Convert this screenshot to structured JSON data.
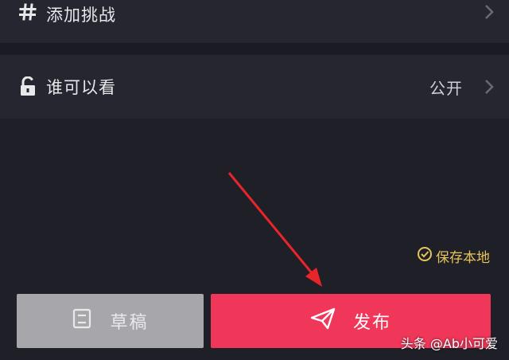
{
  "challenge_row": {
    "label": "添加挑战",
    "icon": "hashtag-icon"
  },
  "privacy_row": {
    "label": "谁可以看",
    "value": "公开",
    "icon": "lock-open-icon"
  },
  "save_local": {
    "label": "保存本地",
    "icon": "check-circle-icon",
    "color": "#e6c45a"
  },
  "buttons": {
    "draft_label": "草稿",
    "draft_icon": "draft-icon",
    "publish_label": "发布",
    "publish_icon": "paper-plane-icon",
    "publish_color": "#f0375a",
    "draft_color": "#a7a7ab"
  },
  "annotation": {
    "arrow_color": "#e8262a"
  },
  "watermark": {
    "text": "头条 @Ab小可爱"
  }
}
